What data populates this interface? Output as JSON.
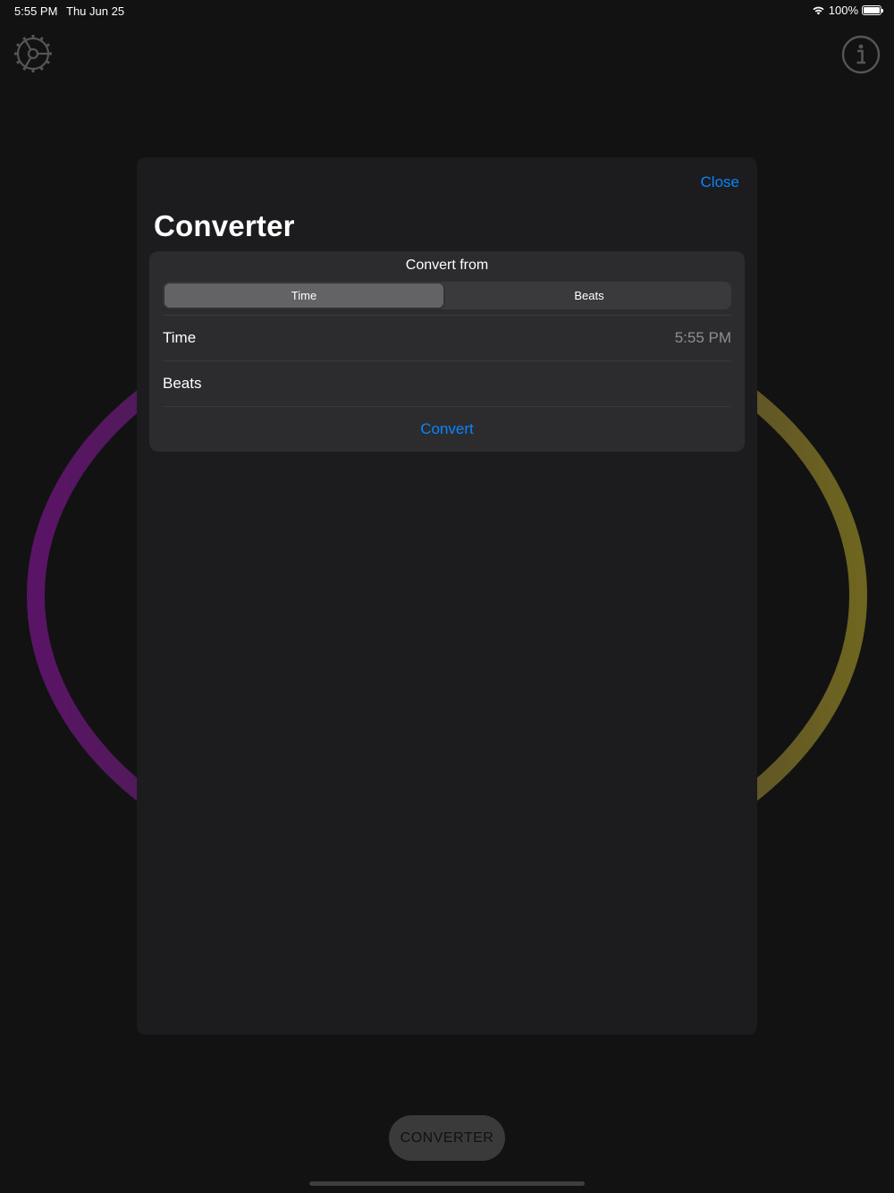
{
  "status_bar": {
    "time": "5:55 PM",
    "date": "Thu Jun 25",
    "battery": "100%"
  },
  "icons": {
    "settings": "gear-icon",
    "info": "info-icon",
    "wifi": "wifi-icon",
    "battery": "battery-icon"
  },
  "ring_colors": {
    "left": "#5a1466",
    "right": "#6e6520"
  },
  "modal": {
    "close_label": "Close",
    "title": "Converter",
    "convert_from_header": "Convert from",
    "segments": [
      "Time",
      "Beats"
    ],
    "selected_segment": "Time",
    "rows": {
      "time_label": "Time",
      "time_value": "5:55 PM",
      "beats_label": "Beats",
      "beats_value": ""
    },
    "convert_label": "Convert"
  },
  "bottom": {
    "converter_button": "CONVERTER"
  },
  "colors": {
    "accent": "#0a84ff",
    "modal_bg": "#1c1c1e",
    "card_bg": "#2c2c2e"
  }
}
